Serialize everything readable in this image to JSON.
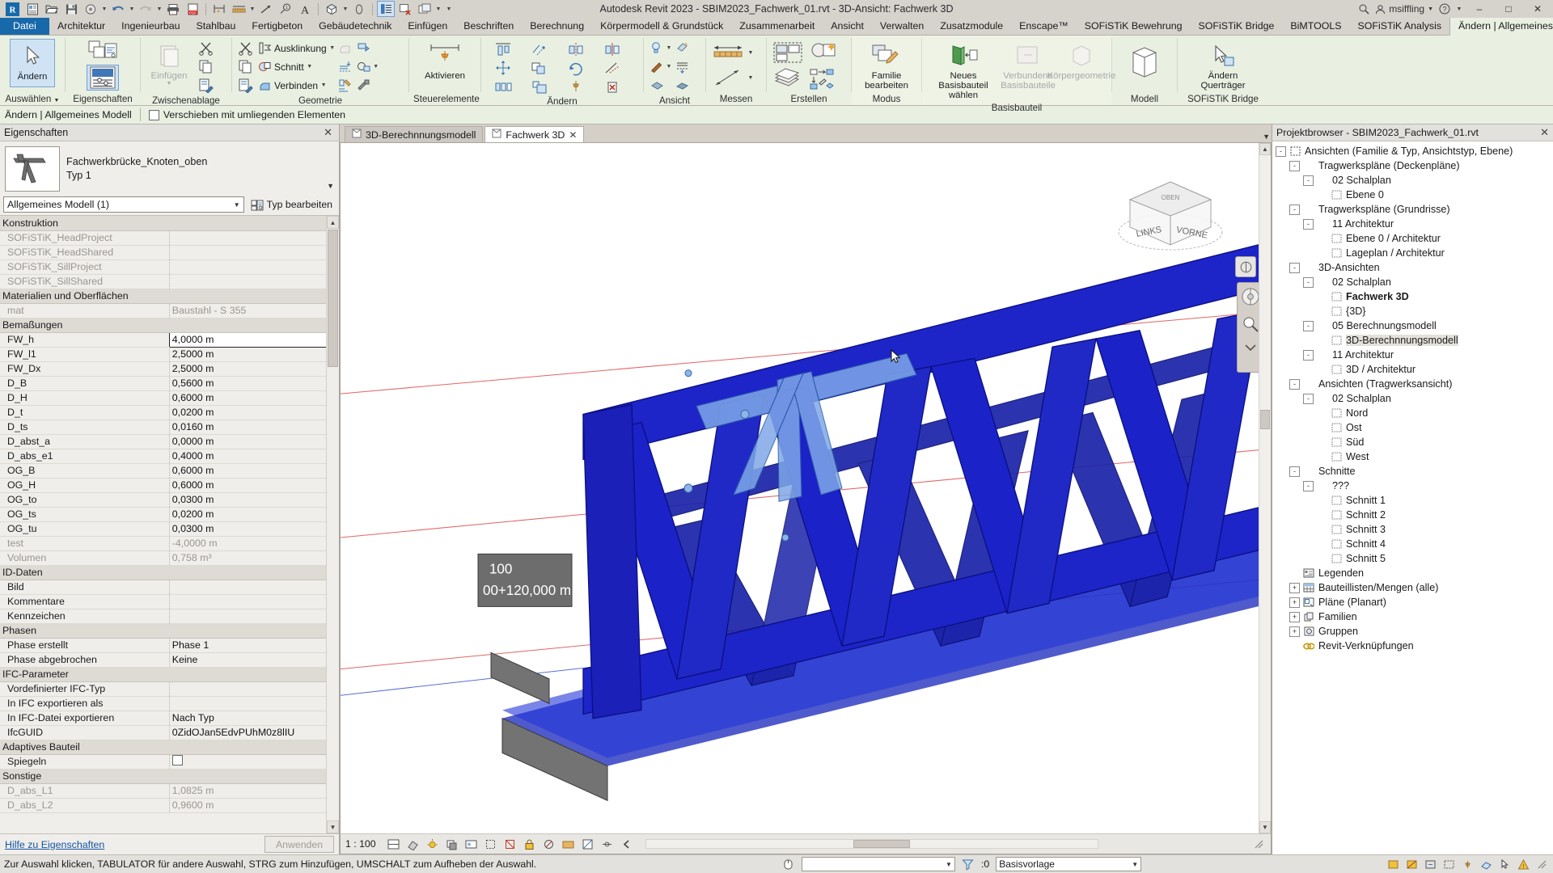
{
  "titlebar": {
    "title": "Autodesk Revit 2023 - SBIM2023_Fachwerk_01.rvt - 3D-Ansicht: Fachwerk 3D",
    "user": "msiffling",
    "search_placeholder": "",
    "qat_items": [
      {
        "name": "app-menu",
        "label": "R"
      },
      {
        "name": "new-sheet",
        "label": "Neu"
      },
      {
        "name": "open",
        "label": "Öffnen"
      },
      {
        "name": "save",
        "label": "Speichern"
      },
      {
        "name": "save-as",
        "label": "Speichern unter"
      },
      {
        "name": "undo",
        "label": "Rückgängig"
      },
      {
        "name": "redo",
        "label": "Wiederherstellen"
      },
      {
        "name": "print",
        "label": "Drucken"
      },
      {
        "name": "export-pdf",
        "label": "PDF exportieren"
      },
      {
        "name": "measure-align",
        "label": "Ausrichten"
      },
      {
        "name": "dimension",
        "label": "Bemaßung"
      },
      {
        "name": "tag",
        "label": "Beschriftung"
      },
      {
        "name": "keynote",
        "label": "Schlüsselnote"
      },
      {
        "name": "text",
        "label": "Text"
      },
      {
        "name": "default-3d",
        "label": "Standard-3D-Ansicht"
      },
      {
        "name": "section",
        "label": "Schnitt"
      },
      {
        "name": "thin-lines",
        "label": "Dünne Linien"
      },
      {
        "name": "close-hidden",
        "label": "Ausgeblendete Fenster schließen"
      },
      {
        "name": "switch-windows",
        "label": "Fenster wechseln"
      },
      {
        "name": "qat-dropdown",
        "label": "Anpassen"
      }
    ],
    "window_buttons": [
      "–",
      "□",
      "✕"
    ]
  },
  "tabs": [
    {
      "label": "Datei",
      "kind": "file"
    },
    {
      "label": "Architektur"
    },
    {
      "label": "Ingenieurbau"
    },
    {
      "label": "Stahlbau"
    },
    {
      "label": "Fertigbeton"
    },
    {
      "label": "Gebäudetechnik"
    },
    {
      "label": "Einfügen"
    },
    {
      "label": "Beschriften"
    },
    {
      "label": "Berechnung"
    },
    {
      "label": "Körpermodell & Grundstück"
    },
    {
      "label": "Zusammenarbeit"
    },
    {
      "label": "Ansicht"
    },
    {
      "label": "Verwalten"
    },
    {
      "label": "Zusatzmodule"
    },
    {
      "label": "Enscape™"
    },
    {
      "label": "SOFiSTiK Bewehrung"
    },
    {
      "label": "SOFiSTiK Bridge"
    },
    {
      "label": "BiMTOOLS"
    },
    {
      "label": "SOFiSTiK Analysis"
    },
    {
      "label": "Ändern | Allgemeines Modell",
      "active": true
    }
  ],
  "ribbon": {
    "panels": [
      {
        "name": "select",
        "label": "Auswählen",
        "has_dropdown": true,
        "buttons": [
          {
            "label": "Ändern",
            "icon": "cursor-arrow-icon",
            "selected": true
          }
        ]
      },
      {
        "name": "properties",
        "label": "Eigenschaften",
        "buttons": [
          {
            "label": "Typeigenschaften",
            "icon": "type-properties-icon"
          },
          {
            "label": "Eigenschaften",
            "icon": "properties-icon",
            "selected": true
          }
        ]
      },
      {
        "name": "clipboard",
        "label": "Zwischenablage",
        "buttons": [
          {
            "label": "Einfügen",
            "icon": "paste-icon",
            "disabled": true
          }
        ],
        "small": [
          {
            "label": "Ausschneiden",
            "icon": "scissors-icon"
          },
          {
            "label": "Kopieren",
            "icon": "copy-icon"
          },
          {
            "label": "Format übertragen",
            "icon": "format-painter-icon"
          }
        ]
      },
      {
        "name": "geometry",
        "label": "Geometrie",
        "small": [
          {
            "label": "Ausklinkung",
            "icon": "cope-icon",
            "caret": true
          },
          {
            "label": "Schnitt",
            "icon": "cut-icon",
            "caret": true
          },
          {
            "label": "Verbinden",
            "icon": "join-icon",
            "caret": true
          }
        ],
        "extra": [
          {
            "label": "Verbindung aufheben",
            "icon": "unjoin-icon",
            "disabled": true
          },
          {
            "label": "Bauteilflächen",
            "icon": "paint-icon"
          },
          {
            "label": "Verbindungsreihenfolge",
            "icon": "switch-join-icon"
          },
          {
            "label": "Trennen",
            "icon": "split-icon"
          },
          {
            "label": "Wandverbindung",
            "icon": "wall-joins-icon",
            "caret": true
          },
          {
            "label": "Wandfuge",
            "icon": "beam-join-icon"
          }
        ]
      },
      {
        "name": "controls",
        "label": "Steuerelemente",
        "buttons": [
          {
            "label": "Aktivieren",
            "icon": "pin-icon"
          }
        ]
      },
      {
        "name": "modify",
        "label": "Ändern",
        "grid": [
          "align-icon",
          "offset-icon",
          "mirror-axis-icon",
          "mirror-pick-icon",
          "move-icon",
          "copy-move-icon",
          "rotate-icon",
          "trim-icon",
          "array-icon",
          "scale-icon",
          "pin-modify-icon",
          "delete-icon"
        ]
      },
      {
        "name": "view",
        "label": "Ansicht",
        "small": [
          {
            "label": "Sichtbarkeit",
            "icon": "lightbulb-icon",
            "caret": true
          },
          {
            "label": "Ansichtsvorlage",
            "icon": "view-template-icon"
          },
          {
            "label": "Linien",
            "icon": "linework-icon",
            "caret": true
          },
          {
            "label": "Bauteile",
            "icon": "parts-icon"
          },
          {
            "label": "Darstellung",
            "icon": "render-icon"
          }
        ]
      },
      {
        "name": "measure",
        "label": "Messen",
        "small": [
          {
            "label": "Maße",
            "icon": "measure-h-icon",
            "caret": true
          },
          {
            "label": "Abstand",
            "icon": "measure-d-icon",
            "caret": true
          }
        ]
      },
      {
        "name": "create",
        "label": "Erstellen",
        "small": [
          {
            "label": "Gruppe erstellen",
            "icon": "create-group-icon"
          },
          {
            "label": "Ähnliche erstellen",
            "icon": "create-similar-icon"
          },
          {
            "label": "Teilgruppe",
            "icon": "group-stack-icon"
          },
          {
            "label": "Muster",
            "icon": "pattern-icon"
          }
        ]
      },
      {
        "name": "mode",
        "label": "Modus",
        "buttons": [
          {
            "label": "Familie bearbeiten",
            "icon": "edit-family-icon"
          }
        ]
      },
      {
        "name": "host",
        "label": "Basisbauteil",
        "buttons": [
          {
            "label": "Neues Basisbauteil wählen",
            "icon": "pick-host-icon"
          },
          {
            "label": "Verbundene Basisbauteile",
            "icon": "linked-host-icon",
            "disabled": true
          },
          {
            "label": "Körpergeometrie",
            "icon": "mass-icon",
            "disabled": true
          }
        ]
      },
      {
        "name": "model",
        "label": "Modell",
        "buttons": [
          {
            "label": "",
            "icon": "model-box-icon"
          }
        ]
      },
      {
        "name": "sofistik-bridge",
        "label": "SOFiSTiK Bridge",
        "buttons": [
          {
            "label": "Ändern Querträger",
            "icon": "cross-beam-icon"
          }
        ]
      }
    ]
  },
  "optionsbar": {
    "context": "Ändern | Allgemeines Modell",
    "checkbox_label": "Verschieben mit umliegenden Elementen",
    "checked": false
  },
  "properties": {
    "header": "Eigenschaften",
    "family_name": "Fachwerkbrücke_Knoten_oben",
    "type_name": "Typ 1",
    "selector_value": "Allgemeines Modell (1)",
    "edit_type_label": "Typ bearbeiten",
    "help_link": "Hilfe zu Eigenschaften",
    "apply_label": "Anwenden",
    "groups": [
      {
        "group": "Konstruktion",
        "rows": [
          {
            "k": "SOFiSTiK_HeadProject",
            "v": "",
            "ro": true
          },
          {
            "k": "SOFiSTiK_HeadShared",
            "v": "",
            "ro": true
          },
          {
            "k": "SOFiSTiK_SillProject",
            "v": "",
            "ro": true
          },
          {
            "k": "SOFiSTiK_SillShared",
            "v": "",
            "ro": true
          }
        ]
      },
      {
        "group": "Materialien und Oberflächen",
        "rows": [
          {
            "k": "mat",
            "v": "Baustahl - S 355",
            "ro": true
          }
        ]
      },
      {
        "group": "Bemaßungen",
        "rows": [
          {
            "k": "FW_h",
            "v": "4,0000 m",
            "edit": true
          },
          {
            "k": "FW_l1",
            "v": "2,5000 m"
          },
          {
            "k": "FW_Dx",
            "v": "2,5000 m"
          },
          {
            "k": "D_B",
            "v": "0,5600 m"
          },
          {
            "k": "D_H",
            "v": "0,6000 m"
          },
          {
            "k": "D_t",
            "v": "0,0200 m"
          },
          {
            "k": "D_ts",
            "v": "0,0160 m"
          },
          {
            "k": "D_abst_a",
            "v": "0,0000 m"
          },
          {
            "k": "D_abs_e1",
            "v": "0,4000 m"
          },
          {
            "k": "OG_B",
            "v": "0,6000 m"
          },
          {
            "k": "OG_H",
            "v": "0,6000 m"
          },
          {
            "k": "OG_to",
            "v": "0,0300 m"
          },
          {
            "k": "OG_ts",
            "v": "0,0200 m"
          },
          {
            "k": "OG_tu",
            "v": "0,0300 m"
          },
          {
            "k": "test",
            "v": "-4,0000 m",
            "ro": true
          },
          {
            "k": "Volumen",
            "v": "0,758 m³",
            "ro": true
          }
        ]
      },
      {
        "group": "ID-Daten",
        "rows": [
          {
            "k": "Bild",
            "v": ""
          },
          {
            "k": "Kommentare",
            "v": ""
          },
          {
            "k": "Kennzeichen",
            "v": ""
          }
        ]
      },
      {
        "group": "Phasen",
        "rows": [
          {
            "k": "Phase erstellt",
            "v": "Phase 1"
          },
          {
            "k": "Phase abgebrochen",
            "v": "Keine"
          }
        ]
      },
      {
        "group": "IFC-Parameter",
        "rows": [
          {
            "k": "Vordefinierter IFC-Typ",
            "v": ""
          },
          {
            "k": "In IFC exportieren als",
            "v": ""
          },
          {
            "k": "In IFC-Datei exportieren",
            "v": "Nach Typ"
          },
          {
            "k": "IfcGUID",
            "v": "0ZidOJan5EdvPUhM0z8lIU"
          }
        ]
      },
      {
        "group": "Adaptives Bauteil",
        "rows": [
          {
            "k": "Spiegeln",
            "v": "",
            "checkbox": true
          }
        ]
      },
      {
        "group": "Sonstige",
        "rows": [
          {
            "k": "D_abs_L1",
            "v": "1,0825 m",
            "ro": true
          },
          {
            "k": "D_abs_L2",
            "v": "0,9600 m",
            "ro": true
          }
        ]
      }
    ]
  },
  "viewtabs": [
    {
      "label": "3D-Berechnnungsmodell",
      "active": false
    },
    {
      "label": "Fachwerk 3D",
      "active": true
    }
  ],
  "canvas": {
    "dimension_label_top": "100",
    "dimension_label_bottom": "00+120,000 m",
    "viewcube_faces": {
      "left": "LINKS",
      "front": "VORNE",
      "top": "OBEN"
    }
  },
  "viewcontrol": {
    "scale": "1 : 100",
    "detail_level": "Mittel",
    "visual_style": "Verdeckte Kante",
    "icons": [
      "crop-view-icon",
      "show-crop-icon",
      "lock-3d-icon",
      "sun-path-icon",
      "shadows-icon",
      "rendering-dialog-icon",
      "visual-style-icon",
      "hide-category-icon",
      "reveal-hidden-icon",
      "temporary-hide-icon",
      "analytical-model-icon",
      "constraints-icon",
      "back-arrow-icon"
    ]
  },
  "browser": {
    "header": "Projektbrowser - SBIM2023_Fachwerk_01.rvt",
    "nodes": [
      {
        "label": "Ansichten (Familie & Typ, Ansichtstyp, Ebene)",
        "depth": 0,
        "exp": "-",
        "icon": "views-icon"
      },
      {
        "label": "Tragwerkspläne (Deckenpläne)",
        "depth": 1,
        "exp": "-"
      },
      {
        "label": "02 Schalplan",
        "depth": 2,
        "exp": "-"
      },
      {
        "label": "Ebene 0",
        "depth": 3,
        "icon": "view-icon"
      },
      {
        "label": "Tragwerkspläne (Grundrisse)",
        "depth": 1,
        "exp": "-"
      },
      {
        "label": "11 Architektur",
        "depth": 2,
        "exp": "-"
      },
      {
        "label": "Ebene 0 / Architektur",
        "depth": 3,
        "icon": "view-icon"
      },
      {
        "label": "Lageplan  / Architektur",
        "depth": 3,
        "icon": "view-icon"
      },
      {
        "label": "3D-Ansichten",
        "depth": 1,
        "exp": "-"
      },
      {
        "label": "02 Schalplan",
        "depth": 2,
        "exp": "-"
      },
      {
        "label": "Fachwerk 3D",
        "depth": 3,
        "icon": "view-icon",
        "bold": true
      },
      {
        "label": "{3D}",
        "depth": 3,
        "icon": "view-icon"
      },
      {
        "label": "05 Berechnungsmodell",
        "depth": 2,
        "exp": "-"
      },
      {
        "label": "3D-Berechnnungsmodell",
        "depth": 3,
        "icon": "view-icon",
        "hl": true
      },
      {
        "label": "11 Architektur",
        "depth": 2,
        "exp": "-"
      },
      {
        "label": "3D / Architektur",
        "depth": 3,
        "icon": "view-icon"
      },
      {
        "label": "Ansichten (Tragwerksansicht)",
        "depth": 1,
        "exp": "-"
      },
      {
        "label": "02 Schalplan",
        "depth": 2,
        "exp": "-"
      },
      {
        "label": "Nord",
        "depth": 3,
        "icon": "view-icon"
      },
      {
        "label": "Ost",
        "depth": 3,
        "icon": "view-icon"
      },
      {
        "label": "Süd",
        "depth": 3,
        "icon": "view-icon"
      },
      {
        "label": "West",
        "depth": 3,
        "icon": "view-icon"
      },
      {
        "label": "Schnitte",
        "depth": 1,
        "exp": "-"
      },
      {
        "label": "???",
        "depth": 2,
        "exp": "-"
      },
      {
        "label": "Schnitt 1",
        "depth": 3,
        "icon": "view-icon"
      },
      {
        "label": "Schnitt 2",
        "depth": 3,
        "icon": "view-icon"
      },
      {
        "label": "Schnitt 3",
        "depth": 3,
        "icon": "view-icon"
      },
      {
        "label": "Schnitt 4",
        "depth": 3,
        "icon": "view-icon"
      },
      {
        "label": "Schnitt 5",
        "depth": 3,
        "icon": "view-icon"
      },
      {
        "label": "Legenden",
        "depth": 1,
        "icon": "legend-icon"
      },
      {
        "label": "Bauteillisten/Mengen (alle)",
        "depth": 1,
        "exp": "+",
        "icon": "schedule-icon"
      },
      {
        "label": "Pläne (Planart)",
        "depth": 1,
        "exp": "+",
        "icon": "sheet-icon"
      },
      {
        "label": "Familien",
        "depth": 1,
        "exp": "+",
        "icon": "family-icon"
      },
      {
        "label": "Gruppen",
        "depth": 1,
        "exp": "+",
        "icon": "group-icon"
      },
      {
        "label": "Revit-Verknüpfungen",
        "depth": 1,
        "icon": "link-icon"
      }
    ]
  },
  "statusbar": {
    "message": "Zur Auswahl klicken, TABULATOR für andere Auswahl, STRG zum Hinzufügen, UMSCHALT zum Aufheben der Auswahl.",
    "filter_value": "",
    "count": ":0",
    "workset_value": "Basisvorlage",
    "right_icons": [
      "exclude-options-icon",
      "filter-icon",
      "editable-icon",
      "design-options-icon",
      "worksets-icon",
      "model-warning-icon",
      "select-link-icon",
      "select-pinned-icon",
      "select-face-icon",
      "drag-select-icon"
    ]
  }
}
